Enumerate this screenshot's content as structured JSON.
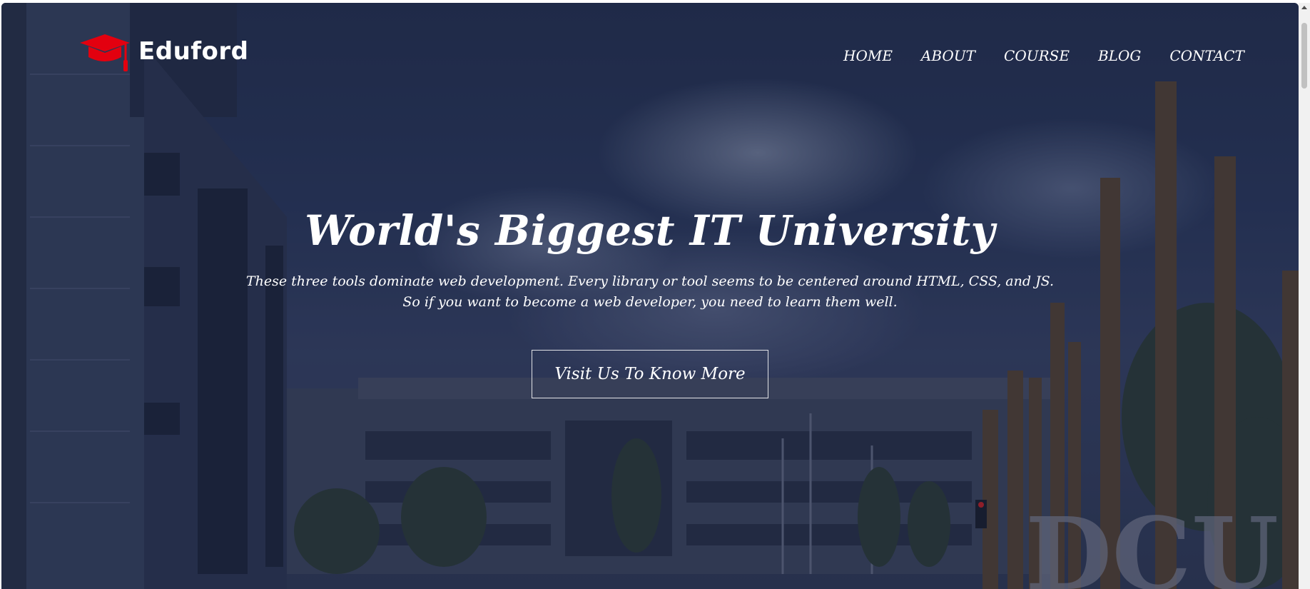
{
  "brand": {
    "name": "Eduford",
    "logo_icon": "graduation-cap-icon",
    "logo_color": "#e3000f"
  },
  "nav": {
    "items": [
      {
        "label": "HOME"
      },
      {
        "label": "ABOUT"
      },
      {
        "label": "COURSE"
      },
      {
        "label": "BLOG"
      },
      {
        "label": "CONTACT"
      }
    ]
  },
  "hero": {
    "title": "World's Biggest IT University",
    "description_line1": "These three tools dominate web development. Every library or tool seems to be centered around HTML, CSS, and JS.",
    "description_line2": "So if you want to become a web developer, you need to learn them well.",
    "cta_label": "Visit Us To Know More",
    "background_sign_text": "DCU"
  },
  "colors": {
    "overlay": "#141c3c",
    "text": "#ffffff",
    "accent": "#e3000f"
  }
}
